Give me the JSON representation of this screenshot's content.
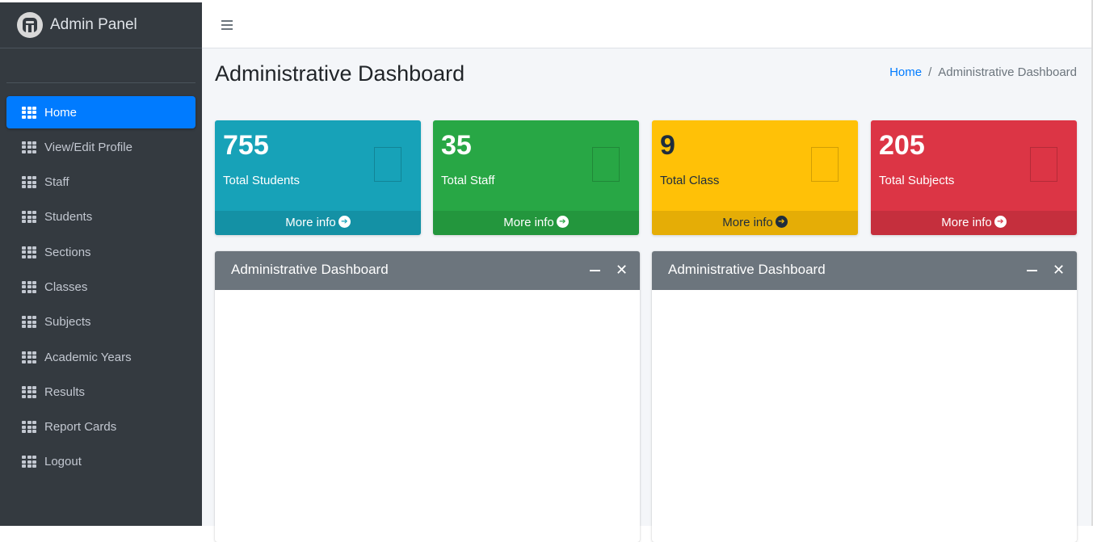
{
  "brand": {
    "title": "Admin Panel"
  },
  "sidebar": {
    "items": [
      {
        "label": "Home",
        "icon": "grid-icon"
      },
      {
        "label": "View/Edit Profile",
        "icon": "grid-icon"
      },
      {
        "label": "Staff",
        "icon": "grid-icon"
      },
      {
        "label": "Students",
        "icon": "grid-icon"
      },
      {
        "label": "Sections",
        "icon": "grid-icon"
      },
      {
        "label": "Classes",
        "icon": "grid-icon"
      },
      {
        "label": "Subjects",
        "icon": "grid-icon"
      },
      {
        "label": "Academic Years",
        "icon": "grid-icon"
      },
      {
        "label": "Results",
        "icon": "grid-icon"
      },
      {
        "label": "Report Cards",
        "icon": "grid-icon"
      },
      {
        "label": "Logout",
        "icon": "grid-icon"
      }
    ],
    "active": "Home"
  },
  "header": {
    "title": "Administrative Dashboard"
  },
  "breadcrumb": {
    "home": "Home",
    "separator": "/",
    "current": "Administrative Dashboard"
  },
  "stats": [
    {
      "value": "755",
      "label": "Total Students",
      "more": "More info",
      "color": "#17a2b8"
    },
    {
      "value": "35",
      "label": "Total Staff",
      "more": "More info",
      "color": "#28a745"
    },
    {
      "value": "9",
      "label": "Total Class",
      "more": "More info",
      "color": "#ffc107"
    },
    {
      "value": "205",
      "label": "Total Subjects",
      "more": "More info",
      "color": "#dc3545"
    }
  ],
  "cards": [
    {
      "title": "Administrative Dashboard"
    },
    {
      "title": "Administrative Dashboard"
    }
  ],
  "icons": {
    "brand": "admin-logo-icon",
    "menu": "hamburger-icon",
    "arrow": "arrow-circle-right-icon",
    "collapse": "minus-icon",
    "remove": "close-icon"
  }
}
